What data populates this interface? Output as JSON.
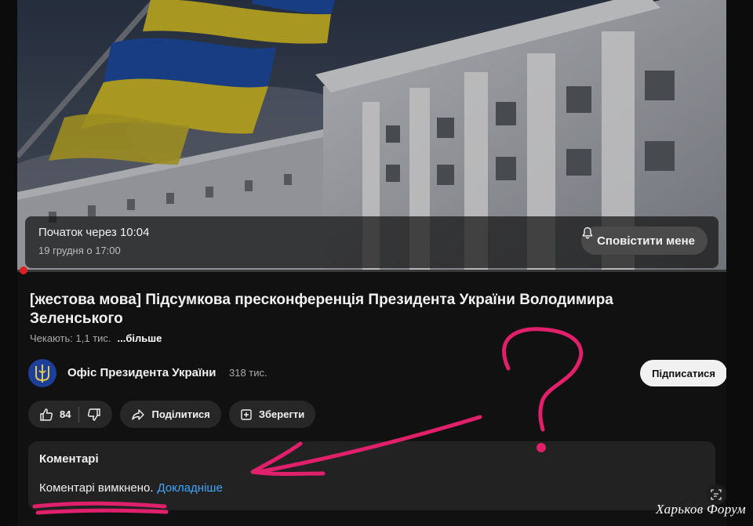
{
  "upcoming": {
    "starts_in": "Початок через 10:04",
    "date": "19 грудня о 17:00",
    "notify_label": "Сповістити мене"
  },
  "video": {
    "title": "[жестова мова] Підсумкова пресконференція Президента України Володимира Зеленського",
    "waiting": "Чекають: 1,1 тис.",
    "more": "...більше"
  },
  "channel": {
    "name": "Офіс Президента України",
    "subscribers": "318 тис.",
    "subscribe_label": "Підписатися"
  },
  "actions": {
    "likes": "84",
    "share_label": "Поділитися",
    "save_label": "Зберегти"
  },
  "comments": {
    "heading": "Коментарі",
    "disabled_text": "Коментарі вимкнено.",
    "learn_more": "Докладніше"
  },
  "overlay": {
    "watermark": "Харьков Форум",
    "annotation_color": "#e0206a"
  }
}
